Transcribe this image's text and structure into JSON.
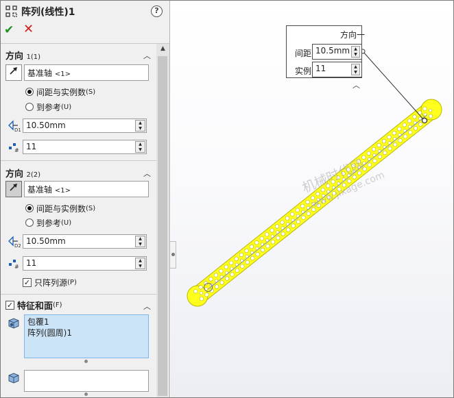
{
  "header": {
    "title": "阵列(线性)1",
    "help_icon": "question-icon",
    "help_label": "?",
    "ok_icon": "check-icon",
    "cancel_icon": "close-icon"
  },
  "direction1": {
    "title": "方向",
    "title_suffix": "1(1)",
    "axis_field": "基准轴",
    "axis_field_suffix": "<1>",
    "radio_spacing": "间距与实例数",
    "radio_spacing_suffix": "(S)",
    "radio_reference": "到参考",
    "radio_reference_suffix": "(U)",
    "spacing_value": "10.50mm",
    "instances_value": "11",
    "selected_mode": "spacing"
  },
  "direction2": {
    "title": "方向",
    "title_suffix": "2(2)",
    "axis_field": "基准轴",
    "axis_field_suffix": "<1>",
    "radio_spacing": "间距与实例数",
    "radio_spacing_suffix": "(S)",
    "radio_reference": "到参考",
    "radio_reference_suffix": "(U)",
    "spacing_value": "10.50mm",
    "instances_value": "11",
    "seed_only_label": "只阵列源",
    "seed_only_suffix": "(P)",
    "seed_only_checked": true,
    "selected_mode": "spacing"
  },
  "features": {
    "title": "特征和面",
    "title_suffix": "(F)",
    "checked": true,
    "items": [
      "包覆1",
      "阵列(圆周)1"
    ]
  },
  "callout": {
    "title": "方向一",
    "spacing_label": "间距:",
    "spacing_value": "10.5mm",
    "instances_label": "实例:",
    "instances_value": "11"
  },
  "watermark": {
    "line1": "机械时代网",
    "line2": "www.jixage.com"
  },
  "colors": {
    "part": "#ffff1e",
    "part_edge": "#b8b800",
    "ok": "#1e8f1e",
    "cancel": "#d01c1c",
    "selection": "#cce4f7"
  }
}
